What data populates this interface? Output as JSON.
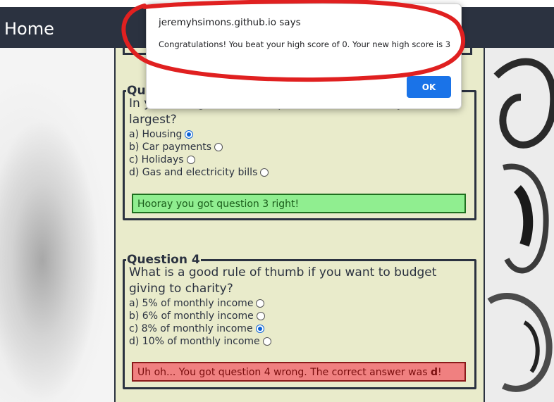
{
  "nav": {
    "home_label": "Home"
  },
  "questions": [
    {
      "legend_fragment": "Qu",
      "text": "In your budget, which expense should usually be the largest?",
      "options": [
        "a) Housing",
        "b) Car payments",
        "c) Holidays",
        "d) Gas and electricity bills"
      ],
      "selected_index": 0,
      "result": {
        "status": "correct",
        "message": "Hooray you got question 3 right!"
      }
    },
    {
      "legend": "Question 4",
      "text": "What is a good rule of thumb if you want to budget giving to charity?",
      "options": [
        "a) 5% of monthly income",
        "b) 6% of monthly income",
        "c) 8% of monthly income",
        "d) 10% of monthly income"
      ],
      "selected_index": 2,
      "result": {
        "status": "wrong",
        "message_prefix": "Uh oh... You got question 4 wrong. The correct answer was ",
        "correct_answer": "d",
        "message_suffix": "!"
      }
    }
  ],
  "dialog": {
    "title": "jeremyhsimons.github.io says",
    "message": "Congratulations! You beat your high score of 0. Your new high score is 3",
    "ok_label": "OK"
  },
  "colors": {
    "navbar": "#2b3240",
    "panel": "#e9ebcb",
    "correct_bg": "#90ee90",
    "wrong_bg": "#f08080",
    "dialog_button": "#1a73e8",
    "annotation": "#e02020"
  }
}
